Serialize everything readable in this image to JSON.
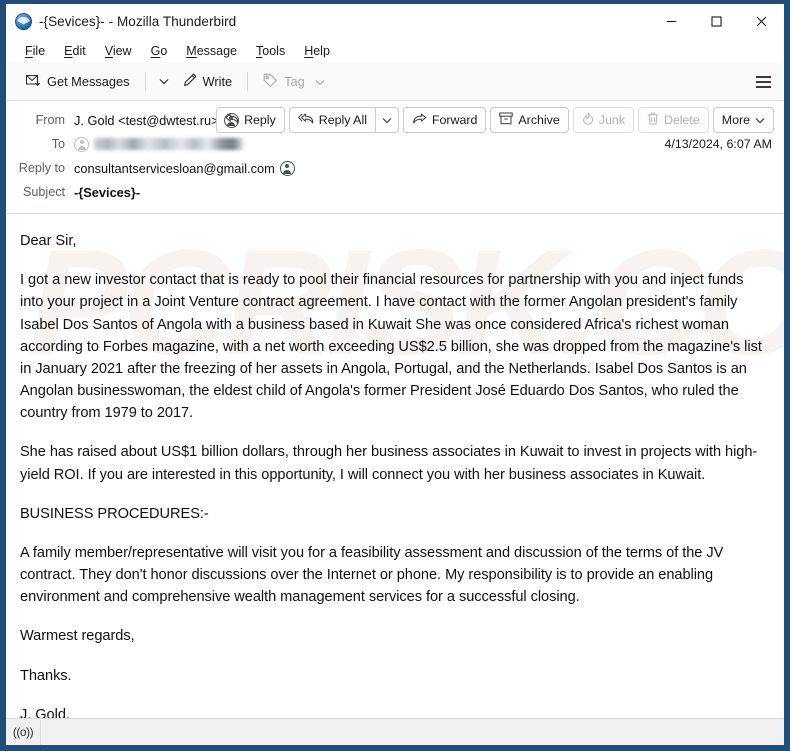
{
  "window": {
    "title": "-{Sevices}- - Mozilla Thunderbird",
    "app_icon": "thunderbird-icon",
    "controls": {
      "minimize": "minimize-icon",
      "maximize": "maximize-icon",
      "close": "close-icon"
    },
    "frame_color": "#1f4e79"
  },
  "menubar": {
    "items": [
      {
        "label": "File",
        "accel": "F"
      },
      {
        "label": "Edit",
        "accel": "E"
      },
      {
        "label": "View",
        "accel": "V"
      },
      {
        "label": "Go",
        "accel": "G"
      },
      {
        "label": "Message",
        "accel": "M"
      },
      {
        "label": "Tools",
        "accel": "T"
      },
      {
        "label": "Help",
        "accel": "H"
      }
    ]
  },
  "toolbar": {
    "get_messages_label": "Get Messages",
    "get_messages_icon": "get-messages-icon",
    "get_messages_caret": "chevron-down-icon",
    "write_label": "Write",
    "write_icon": "pencil-icon",
    "tag_label": "Tag",
    "tag_icon": "tag-icon",
    "tag_caret": "chevron-down-icon",
    "tag_disabled": true,
    "app_menu_icon": "hamburger-icon"
  },
  "message_actions": {
    "reply": {
      "label": "Reply",
      "icon": "reply-icon",
      "disabled": false
    },
    "reply_all": {
      "label": "Reply All",
      "icon": "reply-all-icon",
      "disabled": false,
      "caret": "chevron-down-icon"
    },
    "forward": {
      "label": "Forward",
      "icon": "forward-icon",
      "disabled": false
    },
    "archive": {
      "label": "Archive",
      "icon": "archive-box-icon",
      "disabled": false
    },
    "junk": {
      "label": "Junk",
      "icon": "junk-flame-icon",
      "disabled": true
    },
    "delete": {
      "label": "Delete",
      "icon": "trash-icon",
      "disabled": true
    },
    "more": {
      "label": "More",
      "icon": "chevron-down-icon",
      "disabled": false
    }
  },
  "message_header": {
    "from_label": "From",
    "from_value": "J. Gold <test@dwtest.ru>",
    "from_contact_icon": "contact-icon",
    "to_label": "To",
    "to_value": "",
    "to_redacted": true,
    "reply_to_label": "Reply to",
    "reply_to_value": "consultantservicesloan@gmail.com",
    "reply_to_contact_icon": "contact-icon",
    "subject_label": "Subject",
    "subject_value": "-{Sevices}-",
    "date": "4/13/2024, 6:07 AM"
  },
  "message_body": {
    "watermark": "PCRISK.COM",
    "paragraphs": [
      "Dear Sir,",
      "I got a new investor contact that is ready to pool their financial resources for partnership with you and inject funds into your project in a Joint Venture contract agreement. I have contact with the former Angolan president's family Isabel Dos Santos of Angola with a business based in Kuwait She was once considered Africa's richest woman according to Forbes magazine, with a net worth exceeding US$2.5 billion, she was dropped from the magazine's list in January 2021 after the freezing of her assets in Angola, Portugal, and the Netherlands. Isabel Dos Santos is an Angolan businesswoman, the eldest child of Angola's former President José Eduardo Dos Santos, who ruled the country from 1979 to 2017.",
      "She has raised about US$1 billion dollars, through her business associates in Kuwait to invest in projects with high-yield ROI. If you are interested in this opportunity, I will connect you with her business associates in Kuwait.",
      "BUSINESS PROCEDURES:-",
      "A family member/representative will visit you for a feasibility assessment and discussion of the terms of the JV contract. They don't honor discussions over the Internet or phone. My responsibility is to provide an enabling environment and comprehensive wealth management services for a successful closing.",
      "Warmest regards,",
      "Thanks.",
      "J. Gold."
    ]
  },
  "statusbar": {
    "online_indicator": "((o))",
    "online_icon": "connection-status-icon"
  }
}
